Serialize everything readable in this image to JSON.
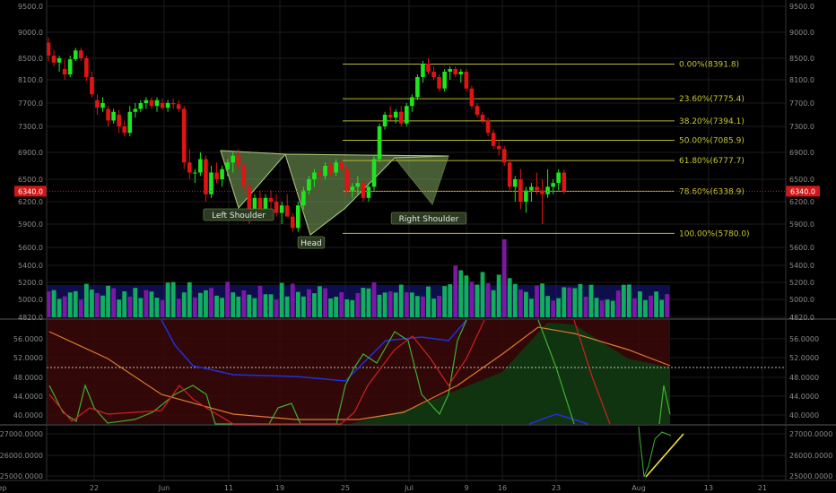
{
  "colors": {
    "up": "#1ee61e",
    "down": "#e01414",
    "fib": "#b8b832",
    "grid": "#1c1c1c",
    "text": "#8a8a8a",
    "current": "#d01818",
    "pattern": "#7fa860",
    "rsi_blue": "#2030e0",
    "rsi_orange": "#e07a30",
    "rsi_green": "#40b030",
    "rsi_red": "#d02020"
  },
  "chart_data": [
    {
      "type": "candlestick",
      "x_labels": [
        {
          "i": 4,
          "text": "22"
        },
        {
          "i": 10,
          "text": "Jun"
        },
        {
          "i": 17,
          "text": "11"
        },
        {
          "i": 21,
          "text": "19"
        },
        {
          "i": 27,
          "text": "25"
        },
        {
          "i": 31,
          "text": "Jul"
        },
        {
          "i": 36,
          "text": "9"
        },
        {
          "i": 40,
          "text": "16"
        },
        {
          "i": 47,
          "text": "23"
        },
        {
          "i": 51,
          "text": "Aug"
        },
        {
          "i": 59,
          "text": "13"
        },
        {
          "i": 64,
          "text": "21"
        },
        {
          "i": 72,
          "text": "Sep"
        }
      ],
      "y_ticks": [
        "9500.0",
        "9000.0",
        "8500.0",
        "8100.0",
        "7700.0",
        "7300.0",
        "6900.0",
        "6500.0",
        "6200.0",
        "5900.0",
        "5600.0",
        "5400.0",
        "5200.0",
        "5000.0",
        "4820.0"
      ],
      "ylim": [
        4820,
        9500
      ],
      "current_price": 6340.0,
      "current_label": "6340.0",
      "candles": [
        {
          "o": 8800,
          "h": 8900,
          "l": 8450,
          "c": 8550
        },
        {
          "o": 8550,
          "h": 8650,
          "l": 8350,
          "c": 8420
        },
        {
          "o": 8420,
          "h": 8550,
          "l": 8250,
          "c": 8500
        },
        {
          "o": 8300,
          "h": 8480,
          "l": 8100,
          "c": 8200
        },
        {
          "o": 8200,
          "h": 8550,
          "l": 8150,
          "c": 8480
        },
        {
          "o": 8480,
          "h": 8700,
          "l": 8450,
          "c": 8650
        },
        {
          "o": 8650,
          "h": 8700,
          "l": 8450,
          "c": 8500
        },
        {
          "o": 8500,
          "h": 8550,
          "l": 8080,
          "c": 8150
        },
        {
          "o": 8150,
          "h": 8250,
          "l": 7800,
          "c": 7850
        },
        {
          "o": 7750,
          "h": 7850,
          "l": 7500,
          "c": 7620
        },
        {
          "o": 7620,
          "h": 7800,
          "l": 7550,
          "c": 7700
        },
        {
          "o": 7600,
          "h": 7650,
          "l": 7300,
          "c": 7400
        },
        {
          "o": 7400,
          "h": 7600,
          "l": 7350,
          "c": 7550
        },
        {
          "o": 7500,
          "h": 7580,
          "l": 7200,
          "c": 7300
        },
        {
          "o": 7300,
          "h": 7400,
          "l": 7150,
          "c": 7200
        },
        {
          "o": 7200,
          "h": 7650,
          "l": 7150,
          "c": 7550
        },
        {
          "o": 7550,
          "h": 7700,
          "l": 7450,
          "c": 7600
        },
        {
          "o": 7600,
          "h": 7750,
          "l": 7550,
          "c": 7700
        },
        {
          "o": 7700,
          "h": 7800,
          "l": 7600,
          "c": 7750
        },
        {
          "o": 7750,
          "h": 7800,
          "l": 7600,
          "c": 7650
        },
        {
          "o": 7650,
          "h": 7800,
          "l": 7550,
          "c": 7750
        },
        {
          "o": 7700,
          "h": 7780,
          "l": 7580,
          "c": 7620
        },
        {
          "o": 7620,
          "h": 7750,
          "l": 7550,
          "c": 7700
        },
        {
          "o": 7700,
          "h": 7780,
          "l": 7600,
          "c": 7680
        },
        {
          "o": 7680,
          "h": 7750,
          "l": 7550,
          "c": 7600
        },
        {
          "o": 7600,
          "h": 7650,
          "l": 6650,
          "c": 6750
        }
      ]
    },
    {
      "type": "volume",
      "y_ticks": [
        "5400.0",
        "5200.0",
        "5000.0",
        "4820.0"
      ]
    },
    {
      "type": "line",
      "name_ticks": [
        "56.0000",
        "52.0000",
        "48.0000",
        "44.0000",
        "40.0000"
      ],
      "ylim": [
        38,
        58
      ]
    },
    {
      "type": "line",
      "name_ticks": [
        "27000.0000",
        "26000.0000",
        "25000.0000"
      ],
      "ylim": [
        24800,
        27200
      ]
    }
  ],
  "fib_levels": [
    {
      "label": "0.00%(8391.8)",
      "price": 8391.8
    },
    {
      "label": "23.60%(7775.4)",
      "price": 7775.4
    },
    {
      "label": "38.20%(7394.1)",
      "price": 7394.1
    },
    {
      "label": "50.00%(7085.9)",
      "price": 7085.9
    },
    {
      "label": "61.80%(6777.7)",
      "price": 6777.7
    },
    {
      "label": "78.60%(6338.9)",
      "price": 6338.9
    },
    {
      "label": "100.00%(5780.0)",
      "price": 5780.0
    }
  ],
  "annotations": {
    "left_shoulder": "Left Shoulder",
    "head": "Head",
    "right_shoulder": "Right Shoulder"
  }
}
